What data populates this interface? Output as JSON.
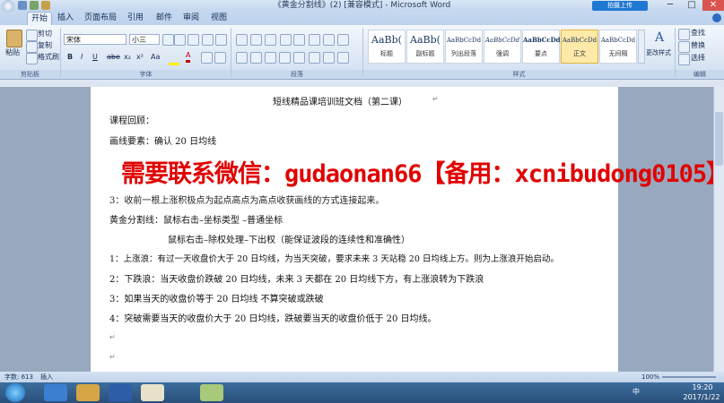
{
  "window": {
    "title": "《黄金分割线》(2) [兼容模式] - Microsoft Word",
    "share_button": "拍摄上传",
    "minimize": "─",
    "maximize": "□",
    "close": "✕"
  },
  "tabs": [
    {
      "label": "开始",
      "active": true
    },
    {
      "label": "插入"
    },
    {
      "label": "页面布局"
    },
    {
      "label": "引用"
    },
    {
      "label": "邮件"
    },
    {
      "label": "审阅"
    },
    {
      "label": "视图"
    }
  ],
  "clipboard": {
    "paste": "粘贴",
    "cut": "剪切",
    "copy": "复制",
    "format_painter": "格式刷",
    "group": "剪贴板"
  },
  "font": {
    "name": "宋体",
    "size": "小三",
    "group": "字体",
    "bold": "B",
    "italic": "I",
    "underline": "U",
    "strike": "abe",
    "sub": "x₂",
    "sup": "x²",
    "case": "Aa",
    "color": "A"
  },
  "paragraph": {
    "group": "段落"
  },
  "styles": {
    "group": "样式",
    "items": [
      {
        "sample": "AaBb(",
        "name": "标题"
      },
      {
        "sample": "AaBb(",
        "name": "副标题"
      },
      {
        "sample": "AaBbCcDd",
        "name": "列出段落"
      },
      {
        "sample": "AaBbCcDd",
        "name": "强调"
      },
      {
        "sample": "AaBbCcDd",
        "name": "要点"
      },
      {
        "sample": "AaBbCcDd",
        "name": "正文",
        "selected": true
      },
      {
        "sample": "AaBbCcDd",
        "name": "无间隔"
      }
    ],
    "change_styles": "更改样式"
  },
  "editing": {
    "group": "编辑",
    "find": "查找",
    "replace": "替换",
    "select": "选择"
  },
  "document": {
    "title": "短线精品课培训班文档（第二课）",
    "lines": [
      "课程回顾：",
      "画线要素：确认 20 日均线",
      "3：收前一根上涨积极点为起点高点为高点收获画线的方式连接起来。",
      "黄金分割线：鼠标右击–坐标类型 –普通坐标",
      "鼠标右击–除权处理–下出权（能保证波段的连续性和准确性）",
      "1：上涨浪：有过一天收盘价大于 20 日均线，为当天突破，要求未来 3 天站稳 20 日均线上方。则为上涨浪开始启动。",
      "2：下跌浪：当天收盘价跌破 20 日均线，未来 3 天都在 20 日均线下方，有上涨浪转为下跌浪",
      "3：如果当天的收盘价等于 20 日均线 不算突破或跌破",
      "4：突破需要当天的收盘价大于 20 日均线，跌破要当天的收盘价低于 20 日均线。"
    ],
    "watermark": "需要联系微信：gudaonan66【备用：xcnibudong0105】"
  },
  "status": {
    "words": "字数: 613",
    "mode": "插入",
    "zoom": "100%"
  },
  "taskbar": {
    "time": "19:20",
    "date": "2017/1/22",
    "ime": "中"
  },
  "colors": {
    "watermark": "#e10000",
    "ribbon": "#dae6f4",
    "taskbar": "#2a4f7a"
  }
}
